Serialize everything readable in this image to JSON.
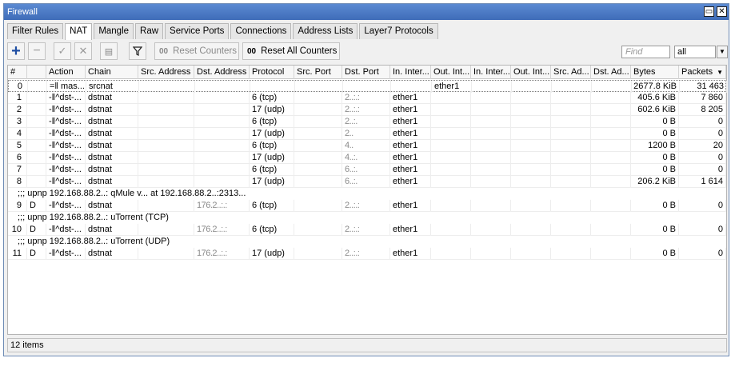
{
  "window": {
    "title": "Firewall"
  },
  "tabs": [
    {
      "label": "Filter Rules"
    },
    {
      "label": "NAT"
    },
    {
      "label": "Mangle"
    },
    {
      "label": "Raw"
    },
    {
      "label": "Service Ports"
    },
    {
      "label": "Connections"
    },
    {
      "label": "Address Lists"
    },
    {
      "label": "Layer7 Protocols"
    }
  ],
  "active_tab": "NAT",
  "toolbar": {
    "reset_counters": "Reset Counters",
    "reset_all_counters": "Reset All Counters",
    "counter_glyph": "00",
    "find_placeholder": "Find",
    "filter_value": "all"
  },
  "columns": [
    "#",
    "",
    "Action",
    "Chain",
    "Src. Address",
    "Dst. Address",
    "Protocol",
    "Src. Port",
    "Dst. Port",
    "In. Inter...",
    "Out. Int...",
    "In. Inter...",
    "Out. Int...",
    "Src. Ad...",
    "Dst. Ad...",
    "Bytes",
    "Packets"
  ],
  "rows": [
    {
      "num": "0",
      "flag": "",
      "action": "=‖ mas...",
      "chain": "srcnat",
      "src": "",
      "dst": "",
      "proto": "",
      "sport": "",
      "dport": "",
      "in": "",
      "out": "ether1",
      "bytes": "2677.8 KiB",
      "packets": "31 463"
    },
    {
      "num": "1",
      "flag": "",
      "action": "-‖^dst-...",
      "chain": "dstnat",
      "src": "",
      "dst": "",
      "proto": "6 (tcp)",
      "sport": "",
      "dport": "2..:.:",
      "in": "ether1",
      "out": "",
      "bytes": "405.6 KiB",
      "packets": "7 860"
    },
    {
      "num": "2",
      "flag": "",
      "action": "-‖^dst-...",
      "chain": "dstnat",
      "src": "",
      "dst": "",
      "proto": "17 (udp)",
      "sport": "",
      "dport": "2..:.:",
      "in": "ether1",
      "out": "",
      "bytes": "602.6 KiB",
      "packets": "8 205"
    },
    {
      "num": "3",
      "flag": "",
      "action": "-‖^dst-...",
      "chain": "dstnat",
      "src": "",
      "dst": "",
      "proto": "6 (tcp)",
      "sport": "",
      "dport": "2..:.",
      "in": "ether1",
      "out": "",
      "bytes": "0 B",
      "packets": "0"
    },
    {
      "num": "4",
      "flag": "",
      "action": "-‖^dst-...",
      "chain": "dstnat",
      "src": "",
      "dst": "",
      "proto": "17 (udp)",
      "sport": "",
      "dport": "2..",
      "in": "ether1",
      "out": "",
      "bytes": "0 B",
      "packets": "0"
    },
    {
      "num": "5",
      "flag": "",
      "action": "-‖^dst-...",
      "chain": "dstnat",
      "src": "",
      "dst": "",
      "proto": "6 (tcp)",
      "sport": "",
      "dport": "4..",
      "in": "ether1",
      "out": "",
      "bytes": "1200 B",
      "packets": "20"
    },
    {
      "num": "6",
      "flag": "",
      "action": "-‖^dst-...",
      "chain": "dstnat",
      "src": "",
      "dst": "",
      "proto": "17 (udp)",
      "sport": "",
      "dport": "4..:.",
      "in": "ether1",
      "out": "",
      "bytes": "0 B",
      "packets": "0"
    },
    {
      "num": "7",
      "flag": "",
      "action": "-‖^dst-...",
      "chain": "dstnat",
      "src": "",
      "dst": "",
      "proto": "6 (tcp)",
      "sport": "",
      "dport": "6..:.",
      "in": "ether1",
      "out": "",
      "bytes": "0 B",
      "packets": "0"
    },
    {
      "num": "8",
      "flag": "",
      "action": "-‖^dst-...",
      "chain": "dstnat",
      "src": "",
      "dst": "",
      "proto": "17 (udp)",
      "sport": "",
      "dport": "6..:.",
      "in": "ether1",
      "out": "",
      "bytes": "206.2 KiB",
      "packets": "1 614"
    },
    {
      "comment": ";;; upnp 192.168.88.2..: qMule v... at 192.168.88.2..:2313..."
    },
    {
      "num": "9",
      "flag": "D",
      "action": "-‖^dst-...",
      "chain": "dstnat",
      "src": "",
      "dst": "176.2..:.:",
      "proto": "6 (tcp)",
      "sport": "",
      "dport": "2..:.:",
      "in": "ether1",
      "out": "",
      "bytes": "0 B",
      "packets": "0"
    },
    {
      "comment": ";;; upnp 192.168.88.2..: uTorrent (TCP)"
    },
    {
      "num": "10",
      "flag": "D",
      "action": "-‖^dst-...",
      "chain": "dstnat",
      "src": "",
      "dst": "176.2..:.:",
      "proto": "6 (tcp)",
      "sport": "",
      "dport": "2..:.:",
      "in": "ether1",
      "out": "",
      "bytes": "0 B",
      "packets": "0"
    },
    {
      "comment": ";;; upnp 192.168.88.2..: uTorrent (UDP)"
    },
    {
      "num": "11",
      "flag": "D",
      "action": "-‖^dst-...",
      "chain": "dstnat",
      "src": "",
      "dst": "176.2..:.:",
      "proto": "17 (udp)",
      "sport": "",
      "dport": "2..:.:",
      "in": "ether1",
      "out": "",
      "bytes": "0 B",
      "packets": "0"
    }
  ],
  "status": {
    "items": "12 items"
  },
  "colors": {
    "title_bar": "#4a78c2",
    "add_icon": "#1f4fa3"
  }
}
